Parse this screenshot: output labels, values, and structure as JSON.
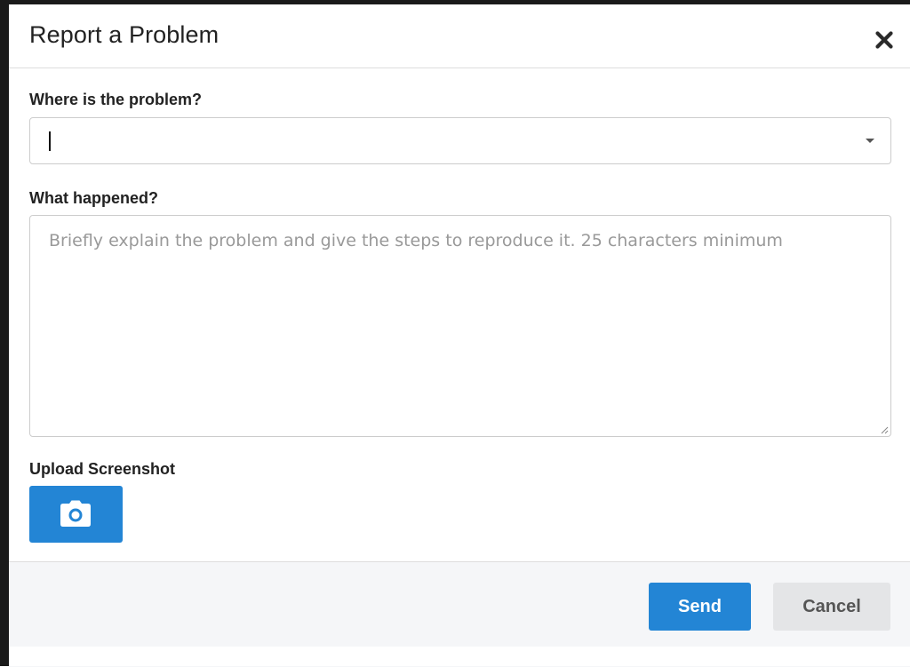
{
  "dialog": {
    "title": "Report a Problem",
    "close_icon": "close-icon"
  },
  "form": {
    "location": {
      "label": "Where is the problem?",
      "value": "",
      "icon": "chevron-down-icon"
    },
    "description": {
      "label": "What happened?",
      "value": "",
      "placeholder": "Briefly explain the problem and give the steps to reproduce it. 25 characters minimum"
    },
    "upload": {
      "label": "Upload Screenshot",
      "icon": "camera-icon"
    }
  },
  "footer": {
    "send_label": "Send",
    "cancel_label": "Cancel"
  },
  "colors": {
    "primary": "#2385d5",
    "cancel_bg": "#e4e5e7",
    "footer_bg": "#f5f6f8",
    "border": "#cccccc",
    "placeholder": "#999999"
  }
}
